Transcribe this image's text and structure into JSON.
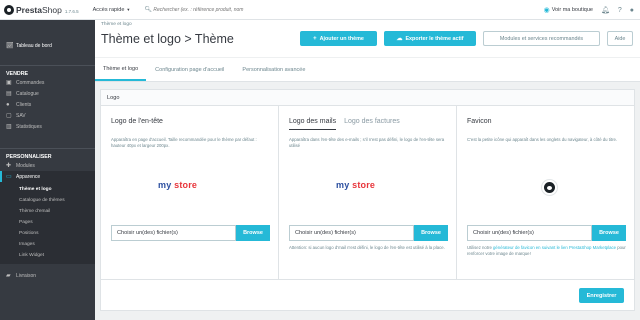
{
  "header": {
    "logo_text_bold": "Presta",
    "logo_text_regular": "Shop",
    "version": "1.7.6.5",
    "quick_access": "Accès rapide",
    "search_placeholder": "Rechercher (ex. : référence produit, nom",
    "view_shop": "Voir ma boutique"
  },
  "sidebar": {
    "dashboard": "Tableau de bord",
    "section_sell": "VENDRE",
    "sell_items": [
      "Commandes",
      "Catalogue",
      "Clients",
      "SAV",
      "Statistiques"
    ],
    "section_customize": "PERSONNALISER",
    "modules": "Modules",
    "appearance": "Apparence",
    "appearance_sub": [
      "Thème et logo",
      "Catalogue de thèmes",
      "Thème d'email",
      "Pages",
      "Positions",
      "Images",
      "Link Widget"
    ],
    "delivery": "Livraison"
  },
  "page": {
    "breadcrumb": "Thème et logo",
    "title": "Thème et logo > Thème",
    "btn_add": "Ajouter un thème",
    "btn_export": "Exporter le thème actif",
    "btn_modules": "Modules et services recommandés",
    "btn_help": "Aide"
  },
  "tabs": [
    "Thème et logo",
    "Configuration page d'accueil",
    "Personnalisation avancée"
  ],
  "panel": {
    "title": "Logo",
    "header_logo": {
      "title": "Logo de l'en-tête",
      "desc": "Apparaîtra en page d'accueil. Taille recommandée pour le thème par défaut : hauteur 40px et largeur 200px.",
      "store_my": "my ",
      "store_st": "store",
      "file_placeholder": "Choisir un(des) fichier(s)",
      "browse": "Browse"
    },
    "mail_logo": {
      "tab_active": "Logo des mails",
      "tab_inactive": "Logo des factures",
      "desc": "Apparaîtra dans l'en-tête des e-mails ; s'il n'est pas défini, le logo de l'en-tête sera utilisé",
      "store_my": "my ",
      "store_st": "store",
      "file_placeholder": "Choisir un(des) fichier(s)",
      "browse": "Browse",
      "note": "Attention: si aucun logo d'mail n'est défini, le logo de l'en-tête est utilisé à la place."
    },
    "favicon": {
      "title": "Favicon",
      "desc": "C'est la petite icône qui apparaît dans les onglets du navigateur, à côté du titre.",
      "file_placeholder": "Choisir un(des) fichier(s)",
      "browse": "Browse",
      "note_pre": "Utilisez notre ",
      "note_link": "générateur de favicon en suivant le lien PrestaShop Marketplace",
      "note_post": " pour renforcer votre image de marque!"
    },
    "save": "Enregistrer"
  },
  "colors": {
    "accent": "#25b9d7",
    "sidebar_bg": "#363a41",
    "sidebar_active_bg": "#2b2e34"
  }
}
